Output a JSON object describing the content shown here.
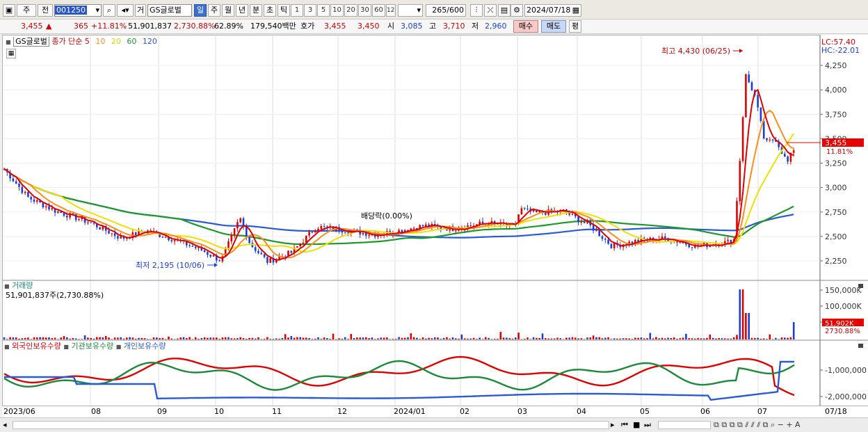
{
  "toolbar": {
    "tab_ju": "주",
    "tab_jeon": "전",
    "stock_code": "001250",
    "tab_geo": "거",
    "stock_name": "GS글로벌",
    "periods": [
      "일",
      "주",
      "월",
      "년",
      "분",
      "초",
      "틱"
    ],
    "active_period": "일",
    "ticks": [
      "1",
      "3",
      "5",
      "10",
      "20",
      "30",
      "60",
      "120"
    ],
    "count": "265",
    "count_max": "/600",
    "date": "2024/07/18"
  },
  "quote": {
    "price": "3,455",
    "arrow": "▲",
    "change": "365",
    "change_pct": "+11.81%",
    "volume": "51,901,837",
    "volume_pct": "2,730.88%",
    "rate": "62.89%",
    "amount": "179,540백만",
    "hoga_label": "호가",
    "ask": "3,455",
    "bid": "3,450",
    "open_label": "시",
    "open": "3,085",
    "high_label": "고",
    "high": "3,710",
    "low_label": "저",
    "low": "2,960",
    "buy_label": "매수",
    "sell_label": "매도",
    "eval_label": "평"
  },
  "price_panel": {
    "stock_tag": "GS글로벌",
    "ma_title": "종가 단순",
    "ma_periods": [
      {
        "period": "5",
        "color": "#e00000"
      },
      {
        "period": "10",
        "color": "#ff8c1a"
      },
      {
        "period": "20",
        "color": "#e6d800"
      },
      {
        "period": "60",
        "color": "#1b9a2a"
      },
      {
        "period": "120",
        "color": "#2a5ad8"
      }
    ],
    "high_annot": "최고 4,430 (06/25)",
    "low_annot": "최저 2,195 (10/06)",
    "dividend_annot": "배당락(0.00%)",
    "lc": "LC:57.40",
    "hc": "HC:-22.01",
    "price_ticks": [
      "4,250",
      "4,000",
      "3,750",
      "3,500",
      "3,250",
      "3,000",
      "2,750",
      "2,500",
      "2,250"
    ],
    "current_tag": "3,455",
    "current_pct": "11.81%"
  },
  "volume_panel": {
    "title": "거래량",
    "value_text": "51,901,837주(2,730.88%)",
    "ticks": [
      "150,000K",
      "100,000K",
      "50,000K"
    ],
    "current_tag": "51,902K",
    "current_pct": "2730.88%"
  },
  "holdings_panel": {
    "series": [
      {
        "name": "외국인보유수량",
        "color": "#e00000"
      },
      {
        "name": "기관보유수량",
        "color": "#1b8a3a"
      },
      {
        "name": "개인보유수량",
        "color": "#2a5ad8"
      }
    ],
    "ticks": [
      "-1,000,000",
      "-2,000,000"
    ]
  },
  "x_axis": [
    "2023/06",
    "08",
    "09",
    "10",
    "11",
    "12",
    "2024/01",
    "02",
    "03",
    "04",
    "05",
    "06",
    "07",
    "07/18"
  ]
}
